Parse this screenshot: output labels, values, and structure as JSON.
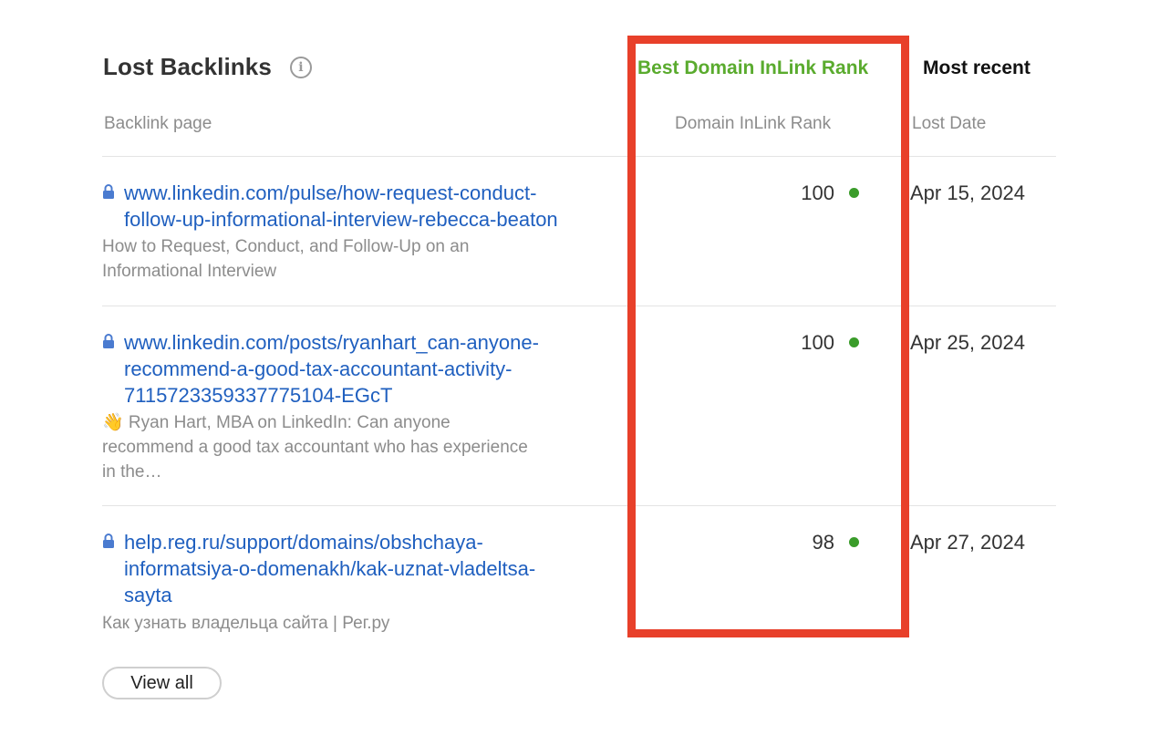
{
  "panel": {
    "title": "Lost Backlinks",
    "info_icon": "info-icon",
    "tabs": [
      {
        "label": "Best Domain InLink Rank",
        "active": true,
        "color": "#5aab2e"
      },
      {
        "label": "Most recent",
        "active": false,
        "color": "#111111"
      }
    ],
    "columns": {
      "page": "Backlink page",
      "rank": "Domain InLink Rank",
      "date": "Lost Date"
    },
    "rows": [
      {
        "url": "www.linkedin.com/pulse/how-request-conduct-follow-up-informational-interview-rebecca-beaton",
        "url_lines": [
          "www.linkedin.com/pulse/how-request-conduct-",
          "follow-up-informational-interview-rebecca-beaton"
        ],
        "description_lines": [
          "How to Request, Conduct, and Follow-Up on an",
          "Informational Interview"
        ],
        "rank": "100",
        "rank_status_color": "#3a9c2a",
        "date": "Apr 15, 2024",
        "icon": "lock-icon"
      },
      {
        "url": "www.linkedin.com/posts/ryanhart_can-anyone-recommend-a-good-tax-accountant-activity-7115723359337775104-EGcT",
        "url_lines": [
          "www.linkedin.com/posts/ryanhart_can-anyone-",
          "recommend-a-good-tax-accountant-activity-",
          "7115723359337775104-EGcT"
        ],
        "description_lines": [
          "👋 Ryan Hart, MBA on LinkedIn: Can anyone",
          "recommend a good tax accountant who has experience",
          "in the…"
        ],
        "rank": "100",
        "rank_status_color": "#3a9c2a",
        "date": "Apr 25, 2024",
        "icon": "lock-icon"
      },
      {
        "url": "help.reg.ru/support/domains/obshchaya-informatsiya-o-domenakh/kak-uznat-vladeltsa-sayta",
        "url_lines": [
          "help.reg.ru/support/domains/obshchaya-",
          "informatsiya-o-domenakh/kak-uznat-vladeltsa-",
          "sayta"
        ],
        "description_lines": [
          "Как узнать владельца сайта | Рег.ру"
        ],
        "rank": "98",
        "rank_status_color": "#3a9c2a",
        "date": "Apr 27, 2024",
        "icon": "lock-icon"
      }
    ],
    "view_all_label": "View all",
    "highlight_color": "#e8402a"
  }
}
